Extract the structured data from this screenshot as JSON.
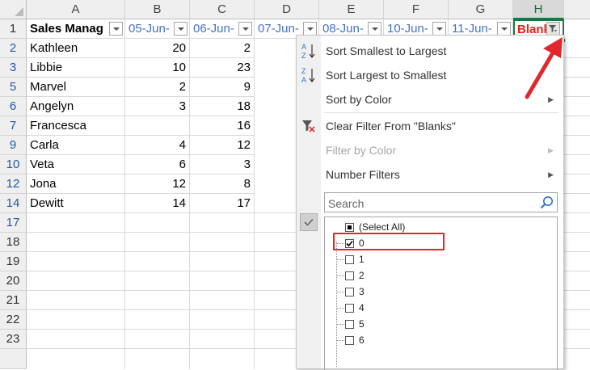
{
  "columns": [
    "A",
    "B",
    "C",
    "D",
    "E",
    "F",
    "G",
    "H"
  ],
  "row_numbers": [
    "1",
    "2",
    "3",
    "5",
    "6",
    "7",
    "9",
    "10",
    "12",
    "14",
    "17",
    "18",
    "19",
    "20",
    "21",
    "22",
    "23"
  ],
  "header": {
    "a": "Sales Manag",
    "b": "05-Jun-",
    "c": "06-Jun-",
    "d": "07-Jun-",
    "e": "08-Jun-",
    "f": "10-Jun-",
    "g": "11-Jun-",
    "h": "Blank"
  },
  "rows": [
    {
      "name": "Kathleen",
      "b": "20",
      "c": "2"
    },
    {
      "name": "Libbie",
      "b": "10",
      "c": "23"
    },
    {
      "name": "Marvel",
      "b": "2",
      "c": "9"
    },
    {
      "name": "Angelyn",
      "b": "3",
      "c": "18"
    },
    {
      "name": "Francesca",
      "b": "",
      "c": "16"
    },
    {
      "name": "Carla",
      "b": "4",
      "c": "12"
    },
    {
      "name": "Veta",
      "b": "6",
      "c": "3"
    },
    {
      "name": "Jona",
      "b": "12",
      "c": "8"
    },
    {
      "name": "Dewitt",
      "b": "14",
      "c": "17"
    }
  ],
  "menu": {
    "sort_asc": "Sort Smallest to Largest",
    "sort_desc": "Sort Largest to Smallest",
    "sort_color": "Sort by Color",
    "clear_filter": "Clear Filter From \"Blanks\"",
    "filter_color": "Filter by Color",
    "number_filters": "Number Filters",
    "search_placeholder": "Search",
    "list": [
      {
        "label": "(Select All)",
        "state": "indeterminate"
      },
      {
        "label": "0",
        "state": "checked"
      },
      {
        "label": "1",
        "state": "unchecked"
      },
      {
        "label": "2",
        "state": "unchecked"
      },
      {
        "label": "3",
        "state": "unchecked"
      },
      {
        "label": "4",
        "state": "unchecked"
      },
      {
        "label": "5",
        "state": "unchecked"
      },
      {
        "label": "6",
        "state": "unchecked"
      }
    ]
  },
  "colors": {
    "accent_green": "#217346",
    "date_blue": "#4472c4",
    "blank_red": "#e8211b",
    "annotation_red": "#e0272e"
  }
}
